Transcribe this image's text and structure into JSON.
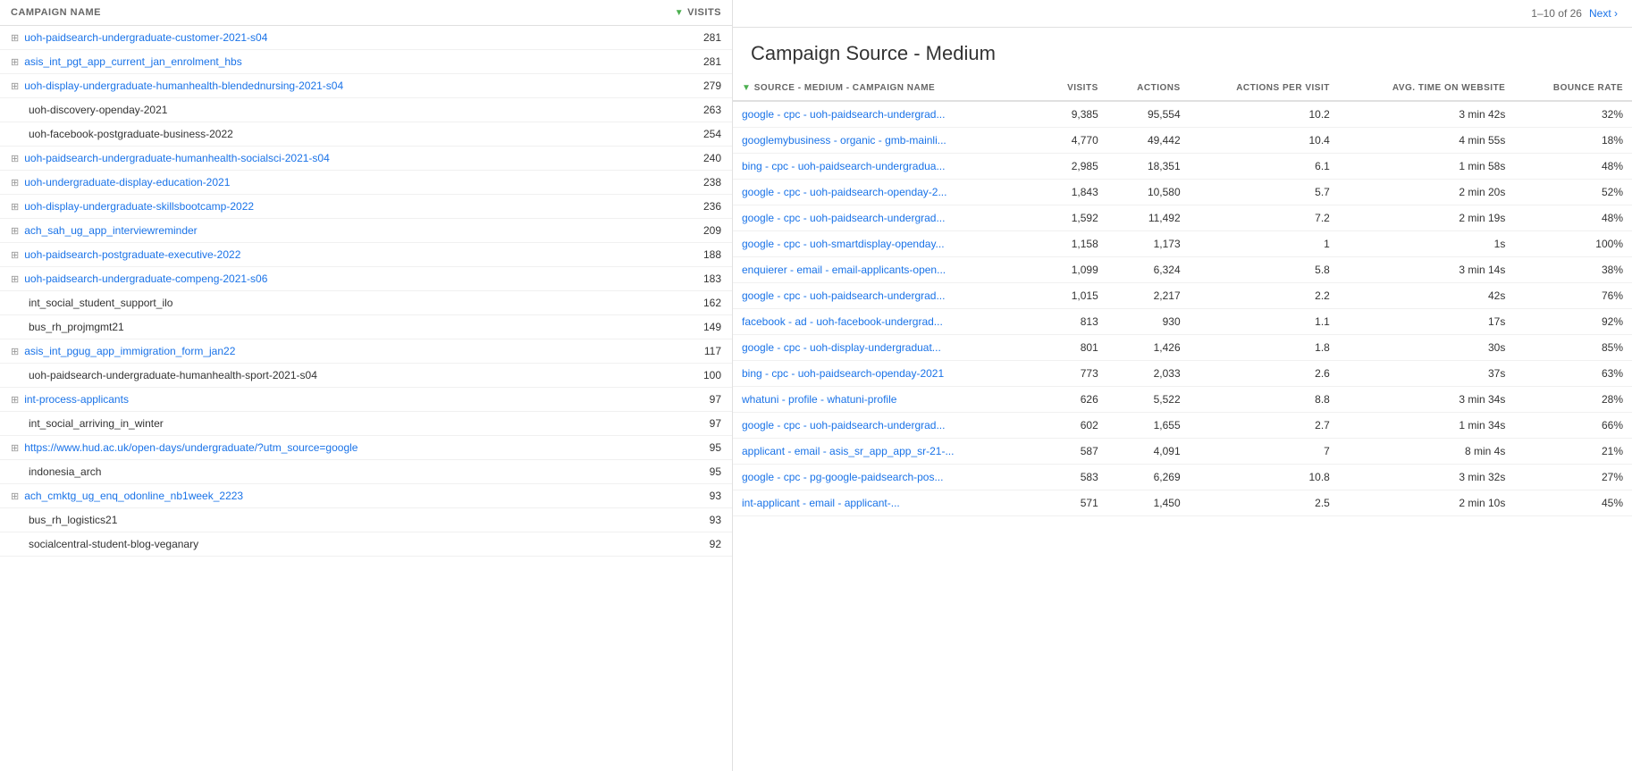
{
  "leftPanel": {
    "headers": {
      "name": "CAMPAIGN NAME",
      "visits": "VISITS"
    },
    "rows": [
      {
        "type": "expandable",
        "name": "uoh-paidsearch-undergraduate-customer-2021-s04",
        "visits": "281",
        "truncated": true
      },
      {
        "type": "expandable",
        "name": "asis_int_pgt_app_current_jan_enrolment_hbs",
        "visits": "281"
      },
      {
        "type": "expandable",
        "name": "uoh-display-undergraduate-humanhealth-blendednursing-2021-s04",
        "visits": "279"
      },
      {
        "type": "plain",
        "name": "uoh-discovery-openday-2021",
        "visits": "263"
      },
      {
        "type": "plain",
        "name": "uoh-facebook-postgraduate-business-2022",
        "visits": "254"
      },
      {
        "type": "expandable",
        "name": "uoh-paidsearch-undergraduate-humanhealth-socialsci-2021-s04",
        "visits": "240"
      },
      {
        "type": "expandable",
        "name": "uoh-undergraduate-display-education-2021",
        "visits": "238"
      },
      {
        "type": "expandable",
        "name": "uoh-display-undergraduate-skillsbootcamp-2022",
        "visits": "236"
      },
      {
        "type": "expandable",
        "name": "ach_sah_ug_app_interviewreminder",
        "visits": "209"
      },
      {
        "type": "expandable",
        "name": "uoh-paidsearch-postgraduate-executive-2022",
        "visits": "188"
      },
      {
        "type": "expandable",
        "name": "uoh-paidsearch-undergraduate-compeng-2021-s06",
        "visits": "183"
      },
      {
        "type": "plain",
        "name": "int_social_student_support_ilo",
        "visits": "162"
      },
      {
        "type": "plain",
        "name": "bus_rh_projmgmt21",
        "visits": "149"
      },
      {
        "type": "expandable",
        "name": "asis_int_pgug_app_immigration_form_jan22",
        "visits": "117"
      },
      {
        "type": "plain",
        "name": "uoh-paidsearch-undergraduate-humanhealth-sport-2021-s04",
        "visits": "100"
      },
      {
        "type": "expandable",
        "name": "int-process-applicants",
        "visits": "97"
      },
      {
        "type": "plain",
        "name": "int_social_arriving_in_winter",
        "visits": "97"
      },
      {
        "type": "expandable",
        "name": "https://www.hud.ac.uk/open-days/undergraduate/?utm_source=google",
        "visits": "95"
      },
      {
        "type": "plain",
        "name": "indonesia_arch",
        "visits": "95"
      },
      {
        "type": "expandable",
        "name": "ach_cmktg_ug_enq_odonline_nb1week_2223",
        "visits": "93"
      },
      {
        "type": "plain",
        "name": "bus_rh_logistics21",
        "visits": "93"
      },
      {
        "type": "plain",
        "name": "socialcentral-student-blog-veganary",
        "visits": "92"
      }
    ]
  },
  "rightPanel": {
    "pagination": {
      "text": "1–10 of 26",
      "next_label": "Next ›"
    },
    "section_title": "Campaign Source - Medium",
    "table": {
      "headers": {
        "source": "SOURCE - MEDIUM - CAMPAIGN NAME",
        "visits": "VISITS",
        "actions": "ACTIONS",
        "actions_per_visit": "ACTIONS PER VISIT",
        "avg_time": "AVG. TIME ON WEBSITE",
        "bounce_rate": "BOUNCE RATE"
      },
      "rows": [
        {
          "source": "google - cpc - uoh-paidsearch-undergrad...",
          "visits": "9,385",
          "actions": "95,554",
          "apv": "10.2",
          "avg_time": "3 min 42s",
          "bounce": "32%"
        },
        {
          "source": "googlemybusiness - organic - gmb-mainli...",
          "visits": "4,770",
          "actions": "49,442",
          "apv": "10.4",
          "avg_time": "4 min 55s",
          "bounce": "18%"
        },
        {
          "source": "bing - cpc - uoh-paidsearch-undergradua...",
          "visits": "2,985",
          "actions": "18,351",
          "apv": "6.1",
          "avg_time": "1 min 58s",
          "bounce": "48%"
        },
        {
          "source": "google - cpc - uoh-paidsearch-openday-2...",
          "visits": "1,843",
          "actions": "10,580",
          "apv": "5.7",
          "avg_time": "2 min 20s",
          "bounce": "52%"
        },
        {
          "source": "google - cpc - uoh-paidsearch-undergrad...",
          "visits": "1,592",
          "actions": "11,492",
          "apv": "7.2",
          "avg_time": "2 min 19s",
          "bounce": "48%"
        },
        {
          "source": "google - cpc - uoh-smartdisplay-openday...",
          "visits": "1,158",
          "actions": "1,173",
          "apv": "1",
          "avg_time": "1s",
          "bounce": "100%"
        },
        {
          "source": "enquierer - email - email-applicants-open...",
          "visits": "1,099",
          "actions": "6,324",
          "apv": "5.8",
          "avg_time": "3 min 14s",
          "bounce": "38%"
        },
        {
          "source": "google - cpc - uoh-paidsearch-undergrad...",
          "visits": "1,015",
          "actions": "2,217",
          "apv": "2.2",
          "avg_time": "42s",
          "bounce": "76%"
        },
        {
          "source": "facebook - ad - uoh-facebook-undergrad...",
          "visits": "813",
          "actions": "930",
          "apv": "1.1",
          "avg_time": "17s",
          "bounce": "92%"
        },
        {
          "source": "google - cpc - uoh-display-undergraduat...",
          "visits": "801",
          "actions": "1,426",
          "apv": "1.8",
          "avg_time": "30s",
          "bounce": "85%"
        },
        {
          "source": "bing - cpc - uoh-paidsearch-openday-2021",
          "visits": "773",
          "actions": "2,033",
          "apv": "2.6",
          "avg_time": "37s",
          "bounce": "63%"
        },
        {
          "source": "whatuni - profile - whatuni-profile",
          "visits": "626",
          "actions": "5,522",
          "apv": "8.8",
          "avg_time": "3 min 34s",
          "bounce": "28%"
        },
        {
          "source": "google - cpc - uoh-paidsearch-undergrad...",
          "visits": "602",
          "actions": "1,655",
          "apv": "2.7",
          "avg_time": "1 min 34s",
          "bounce": "66%"
        },
        {
          "source": "applicant - email - asis_sr_app_app_sr-21-...",
          "visits": "587",
          "actions": "4,091",
          "apv": "7",
          "avg_time": "8 min 4s",
          "bounce": "21%"
        },
        {
          "source": "google - cpc - pg-google-paidsearch-pos...",
          "visits": "583",
          "actions": "6,269",
          "apv": "10.8",
          "avg_time": "3 min 32s",
          "bounce": "27%"
        },
        {
          "source": "int-applicant - email - applicant-...",
          "visits": "571",
          "actions": "1,450",
          "apv": "2.5",
          "avg_time": "2 min 10s",
          "bounce": "45%"
        }
      ]
    }
  }
}
